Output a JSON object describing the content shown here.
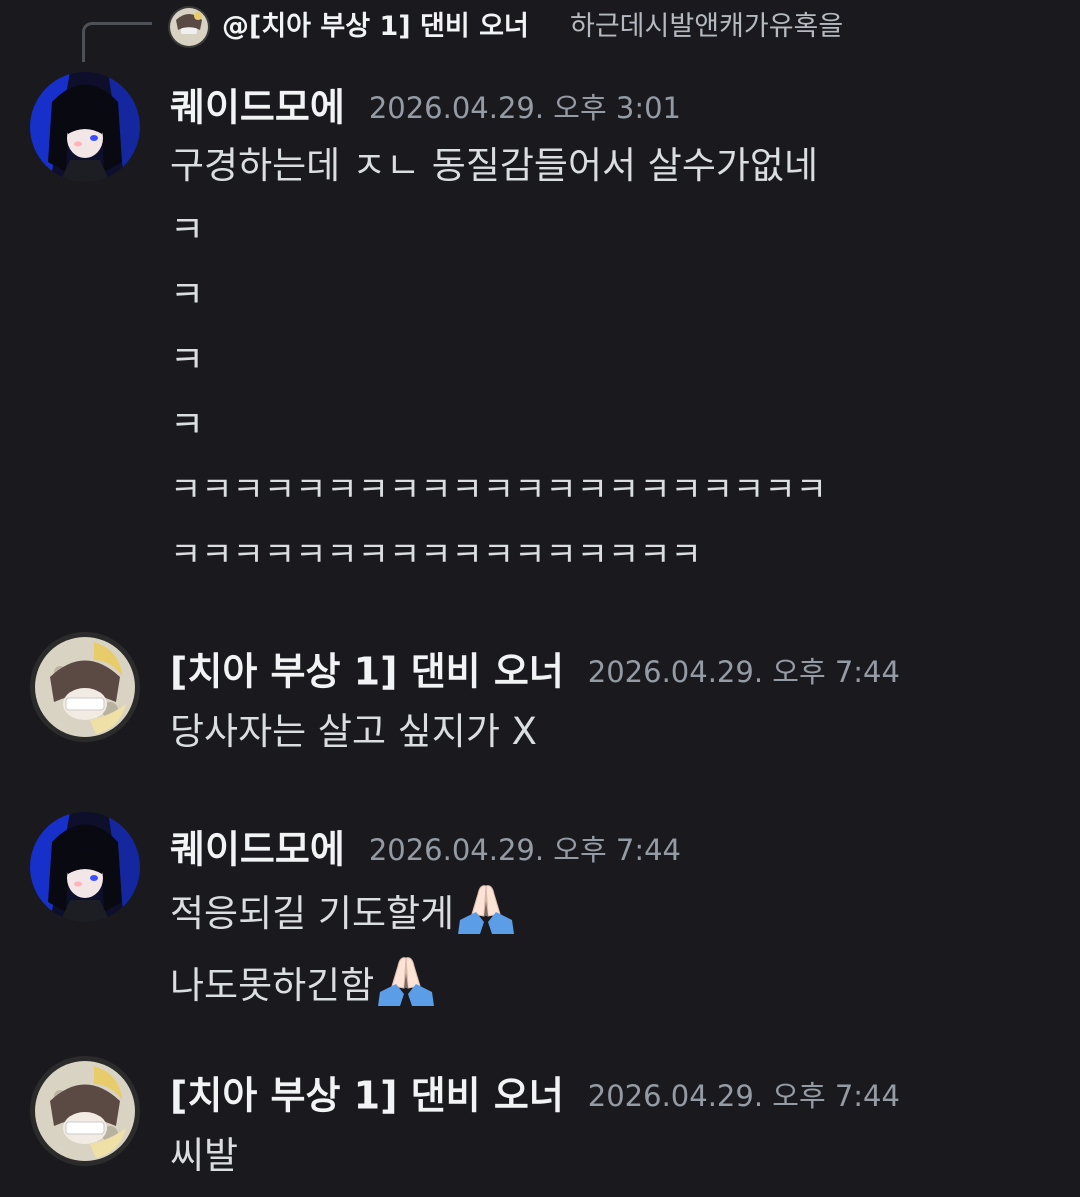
{
  "reply": {
    "author": "@[치아 부상 1] 댄비 오너",
    "preview": "하근데시발앤캐가유혹을"
  },
  "messages": [
    {
      "author": "퀘이드모에",
      "timestamp": "2026.04.29. 오후 3:01",
      "avatar_icon": "dark-hair-blue-avatar",
      "lines": [
        "구경하는데 ㅈㄴ 동질감들어서 살수가없네",
        "ㅋ",
        "ㅋ",
        "ㅋ",
        "ㅋ",
        "ㅋㅋㅋㅋㅋㅋㅋㅋㅋㅋㅋㅋㅋㅋㅋㅋㅋㅋㅋㅋㅋ",
        "ㅋㅋㅋㅋㅋㅋㅋㅋㅋㅋㅋㅋㅋㅋㅋㅋㅋ"
      ]
    },
    {
      "author": "[치아 부상 1] 댄비 오너",
      "timestamp": "2026.04.29. 오후 7:44",
      "avatar_icon": "moon-character-avatar",
      "lines": [
        "당사자는 살고 싶지가 X"
      ]
    },
    {
      "author": "퀘이드모에",
      "timestamp": "2026.04.29. 오후 7:44",
      "avatar_icon": "dark-hair-blue-avatar",
      "lines": [
        "적응되길 기도할게",
        "나도못하긴함"
      ],
      "line_emoji": [
        "folded-hands-icon",
        "folded-hands-icon"
      ]
    },
    {
      "author": "[치아 부상 1] 댄비 오너",
      "timestamp": "2026.04.29. 오후 7:44",
      "avatar_icon": "moon-character-avatar",
      "lines": [
        "씨발"
      ]
    }
  ],
  "colors": {
    "background": "#1a1a1e",
    "author": "#f2f3f5",
    "timestamp": "#949ba4",
    "text": "#dbdee1"
  }
}
